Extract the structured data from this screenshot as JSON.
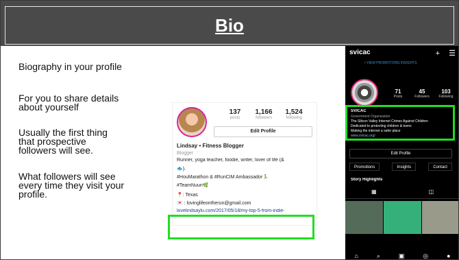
{
  "slide": {
    "title": "Bio",
    "bullets": [
      "Biography in your profile",
      "For you to share details about yourself",
      "Usually the first thing that prospective followers will see.",
      "What followers will see every time they visit your profile."
    ]
  },
  "profile_example": {
    "stats": [
      {
        "value": "137",
        "label": "posts"
      },
      {
        "value": "1,166",
        "label": "followers"
      },
      {
        "value": "1,524",
        "label": "following"
      }
    ],
    "edit_button": "Edit Profile",
    "name": "Lindsay • Fitness Blogger",
    "category": "Blogger",
    "bio_lines": [
      "Runner, yoga teacher, foodie, writer, lover of life (&",
      "🐟).",
      "#HouMarathon & #RunCIM Ambassador🏃",
      "#TeamNuun🌿",
      "📍: Texas",
      "💌 : lovinglifeontherun@gmail.com",
      "lovelindsaylu.com/2017/05/18/my-top-5-from-indie-"
    ]
  },
  "phone_example": {
    "username": "svicac",
    "top_icons": [
      "+",
      "☰"
    ],
    "link_text": "• VIEW PROMOTIONS INSIGHTS",
    "stats": [
      {
        "value": "71",
        "label": "Posts"
      },
      {
        "value": "45",
        "label": "Followers"
      },
      {
        "value": "103",
        "label": "Following"
      }
    ],
    "bio_lines": [
      "SVICAC",
      "Government Organization",
      "The Silicon Valley Internet Crimes Against Children",
      "Dedicated to protecting children & teens",
      "Making the internet a safer place",
      "www.svicac.org/"
    ],
    "edit_button": "Edit Profile",
    "actions": [
      "Promotions",
      "Insights",
      "Contact"
    ],
    "story_highlights": "Story Highlights",
    "nav_icons": [
      "⌂",
      "⌕",
      "▣",
      "◎",
      "●"
    ]
  },
  "colors": {
    "header": "#4a4a4a",
    "highlight": "#22dd22"
  }
}
